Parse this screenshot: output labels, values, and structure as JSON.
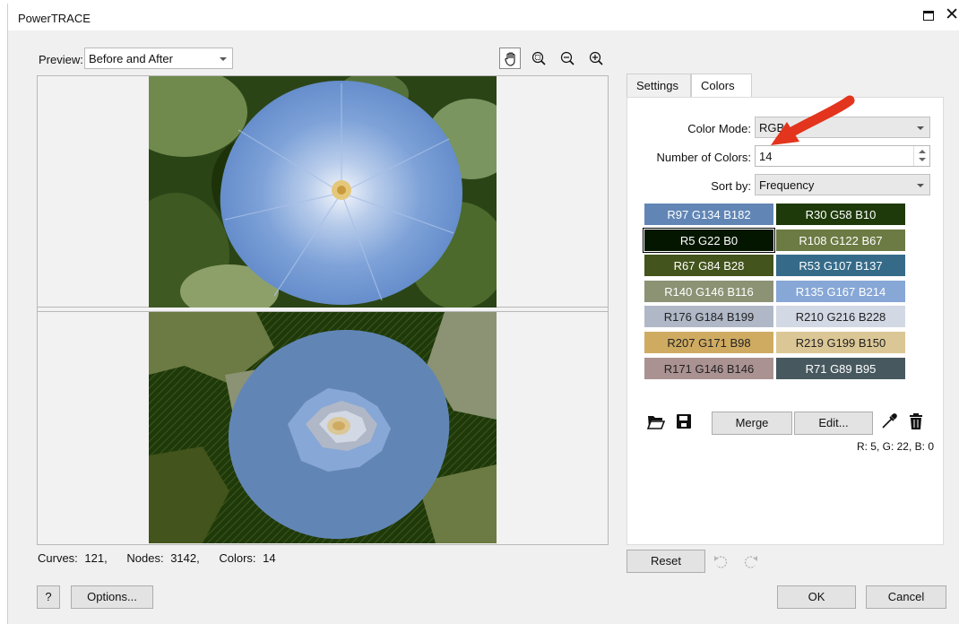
{
  "window": {
    "title": "PowerTRACE"
  },
  "preview": {
    "label": "Preview:",
    "selected": "Before and After"
  },
  "stats": {
    "curves_label": "Curves:",
    "curves_value": "121,",
    "nodes_label": "Nodes:",
    "nodes_value": "3142,",
    "colors_label": "Colors:",
    "colors_value": "14"
  },
  "tabs": [
    {
      "label": "Settings"
    },
    {
      "label": "Colors"
    }
  ],
  "colors_tab": {
    "color_mode_label": "Color Mode:",
    "color_mode_value": "RGB",
    "num_colors_label": "Number of Colors:",
    "num_colors_value": "14",
    "sort_label": "Sort by:",
    "sort_value": "Frequency",
    "swatches": [
      {
        "label": "R97 G134 B182",
        "color": "#6186b6",
        "text": "#ffffff"
      },
      {
        "label": "R30 G58 B10",
        "color": "#1e3a0a",
        "text": "#ffffff"
      },
      {
        "label": "R5 G22 B0",
        "color": "#051600",
        "text": "#ffffff"
      },
      {
        "label": "R108 G122 B67",
        "color": "#6c7a43",
        "text": "#ffffff"
      },
      {
        "label": "R67 G84 B28",
        "color": "#43541c",
        "text": "#ffffff"
      },
      {
        "label": "R53 G107 B137",
        "color": "#356b89",
        "text": "#ffffff"
      },
      {
        "label": "R140 G146 B116",
        "color": "#8c9274",
        "text": "#ffffff"
      },
      {
        "label": "R135 G167 B214",
        "color": "#87a7d6",
        "text": "#ffffff"
      },
      {
        "label": "R176 G184 B199",
        "color": "#b0b8c7",
        "text": "#222222"
      },
      {
        "label": "R210 G216 B228",
        "color": "#d2d8e4",
        "text": "#222222"
      },
      {
        "label": "R207 G171 B98",
        "color": "#cfab62",
        "text": "#222222"
      },
      {
        "label": "R219 G199 B150",
        "color": "#dbc796",
        "text": "#222222"
      },
      {
        "label": "R171 G146 B146",
        "color": "#ab9292",
        "text": "#222222"
      },
      {
        "label": "R71 G89 B95",
        "color": "#47595f",
        "text": "#ffffff"
      }
    ],
    "merge_label": "Merge",
    "edit_label": "Edit...",
    "rgb_readout": "R: 5, G: 22, B: 0"
  },
  "buttons": {
    "reset": "Reset",
    "help": "?",
    "options": "Options...",
    "ok": "OK",
    "cancel": "Cancel"
  },
  "icons": {
    "hand": "hand-pan-icon",
    "zoom_fit": "zoom-fit-icon",
    "zoom_out": "zoom-out-icon",
    "zoom_in": "zoom-in-icon",
    "open": "folder-open-icon",
    "save": "save-icon",
    "eyedropper": "eyedropper-icon",
    "delete": "trash-icon",
    "undo": "undo-icon",
    "redo": "redo-icon"
  },
  "accent": {
    "annotation_arrow": "#e3341d"
  }
}
